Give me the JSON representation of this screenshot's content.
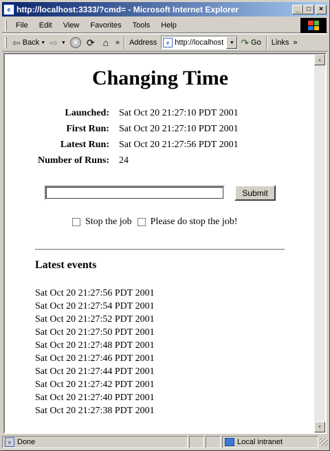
{
  "window": {
    "title": "http://localhost:3333/?cmd= - Microsoft Internet Explorer",
    "minimize": "_",
    "maximize": "□",
    "close": "×"
  },
  "menu": [
    "File",
    "Edit",
    "View",
    "Favorites",
    "Tools",
    "Help"
  ],
  "toolbar": {
    "back_label": "Back",
    "more_glyph": "»",
    "address_label": "Address",
    "address_value": "http://localhost",
    "go_label": "Go",
    "links_label": "Links"
  },
  "page": {
    "title": "Changing Time",
    "info": [
      {
        "label": "Launched:",
        "value": "Sat Oct 20 21:27:10 PDT 2001"
      },
      {
        "label": "First Run:",
        "value": "Sat Oct 20 21:27:10 PDT 2001"
      },
      {
        "label": "Latest Run:",
        "value": "Sat Oct 20 21:27:56 PDT 2001"
      },
      {
        "label": "Number of Runs:",
        "value": "24"
      }
    ],
    "input_value": "",
    "submit_label": "Submit",
    "checkbox1_label": "Stop the job",
    "checkbox2_label": "Please do stop the job!",
    "events_title": "Latest events",
    "events": [
      "Sat Oct 20 21:27:56 PDT 2001",
      "Sat Oct 20 21:27:54 PDT 2001",
      "Sat Oct 20 21:27:52 PDT 2001",
      "Sat Oct 20 21:27:50 PDT 2001",
      "Sat Oct 20 21:27:48 PDT 2001",
      "Sat Oct 20 21:27:46 PDT 2001",
      "Sat Oct 20 21:27:44 PDT 2001",
      "Sat Oct 20 21:27:42 PDT 2001",
      "Sat Oct 20 21:27:40 PDT 2001",
      "Sat Oct 20 21:27:38 PDT 2001"
    ]
  },
  "status": {
    "text": "Done",
    "zone": "Local intranet"
  },
  "colors": {
    "titlebar_start": "#0a246a",
    "titlebar_end": "#a6caf0",
    "chrome": "#d4d0c8"
  }
}
